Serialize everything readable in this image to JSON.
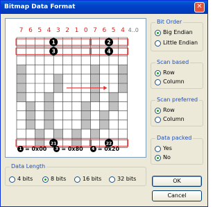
{
  "window": {
    "title": "Bitmap Data Format",
    "close_glyph": "✕"
  },
  "grid": {
    "bit_numbers": [
      "7",
      "6",
      "5",
      "4",
      "3",
      "2",
      "1",
      "0",
      "7",
      "6",
      "5",
      "4"
    ],
    "overflow_label": "4..0",
    "markers": {
      "m1": "1",
      "m2": "2",
      "m3": "3",
      "m4": "4",
      "m21": "21",
      "m22": "22"
    },
    "marker_color": "#000000",
    "bit_number_color": "#e02020",
    "highlight_color": "#e03030",
    "filled_color": "#c0c0c0",
    "legend": [
      {
        "marker": "1",
        "text": "= 0x00"
      },
      {
        "marker": "3",
        "text": "= 0x80"
      },
      {
        "marker": "4",
        "text": "= 0x20"
      }
    ]
  },
  "bit_order": {
    "legend": "Bit Order",
    "options": [
      "Big Endian",
      "Little Endian"
    ],
    "selected": "Big Endian"
  },
  "scan_based": {
    "legend": "Scan based",
    "options": [
      "Row",
      "Column"
    ],
    "selected": "Row"
  },
  "scan_preferred": {
    "legend": "Scan preferred",
    "options": [
      "Row",
      "Column"
    ],
    "selected": "Row"
  },
  "data_packed": {
    "legend": "Data packed",
    "options": [
      "Yes",
      "No"
    ],
    "selected": "No"
  },
  "data_length": {
    "legend": "Data Length",
    "options": [
      "4 bits",
      "8 bits",
      "16 bits",
      "32 bits"
    ],
    "selected": "8 bits"
  },
  "buttons": {
    "ok": "OK",
    "cancel": "Cancel"
  }
}
